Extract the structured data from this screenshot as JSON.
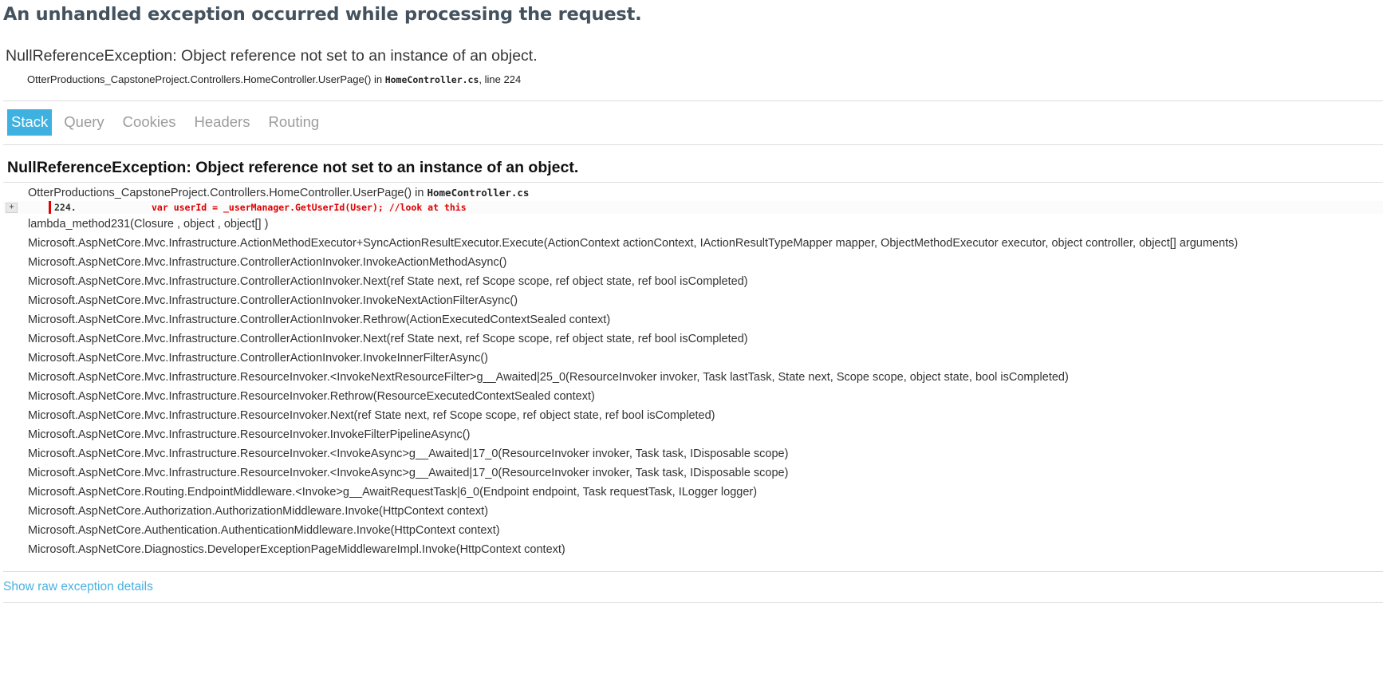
{
  "page": {
    "title": "An unhandled exception occurred while processing the request.",
    "summary": "NullReferenceException: Object reference not set to an instance of an object.",
    "location_method": "OtterProductions_CapstoneProject.Controllers.HomeController.UserPage() in ",
    "location_file": "HomeController.cs",
    "location_line": ", line 224"
  },
  "tabs": [
    {
      "label": "Stack",
      "selected": true
    },
    {
      "label": "Query",
      "selected": false
    },
    {
      "label": "Cookies",
      "selected": false
    },
    {
      "label": "Headers",
      "selected": false
    },
    {
      "label": "Routing",
      "selected": false
    }
  ],
  "stack": {
    "title": "NullReferenceException: Object reference not set to an instance of an object.",
    "first_frame_method": "OtterProductions_CapstoneProject.Controllers.HomeController.UserPage() in ",
    "first_frame_file": "HomeController.cs",
    "expander_label": "+",
    "code_line_number": "224.",
    "code_line_text": "var userId = _userManager.GetUserId(User); //look at this",
    "frames": [
      "lambda_method231(Closure , object , object[] )",
      "Microsoft.AspNetCore.Mvc.Infrastructure.ActionMethodExecutor+SyncActionResultExecutor.Execute(ActionContext actionContext, IActionResultTypeMapper mapper, ObjectMethodExecutor executor, object controller, object[] arguments)",
      "Microsoft.AspNetCore.Mvc.Infrastructure.ControllerActionInvoker.InvokeActionMethodAsync()",
      "Microsoft.AspNetCore.Mvc.Infrastructure.ControllerActionInvoker.Next(ref State next, ref Scope scope, ref object state, ref bool isCompleted)",
      "Microsoft.AspNetCore.Mvc.Infrastructure.ControllerActionInvoker.InvokeNextActionFilterAsync()",
      "Microsoft.AspNetCore.Mvc.Infrastructure.ControllerActionInvoker.Rethrow(ActionExecutedContextSealed context)",
      "Microsoft.AspNetCore.Mvc.Infrastructure.ControllerActionInvoker.Next(ref State next, ref Scope scope, ref object state, ref bool isCompleted)",
      "Microsoft.AspNetCore.Mvc.Infrastructure.ControllerActionInvoker.InvokeInnerFilterAsync()",
      "Microsoft.AspNetCore.Mvc.Infrastructure.ResourceInvoker.<InvokeNextResourceFilter>g__Awaited|25_0(ResourceInvoker invoker, Task lastTask, State next, Scope scope, object state, bool isCompleted)",
      "Microsoft.AspNetCore.Mvc.Infrastructure.ResourceInvoker.Rethrow(ResourceExecutedContextSealed context)",
      "Microsoft.AspNetCore.Mvc.Infrastructure.ResourceInvoker.Next(ref State next, ref Scope scope, ref object state, ref bool isCompleted)",
      "Microsoft.AspNetCore.Mvc.Infrastructure.ResourceInvoker.InvokeFilterPipelineAsync()",
      "Microsoft.AspNetCore.Mvc.Infrastructure.ResourceInvoker.<InvokeAsync>g__Awaited|17_0(ResourceInvoker invoker, Task task, IDisposable scope)",
      "Microsoft.AspNetCore.Mvc.Infrastructure.ResourceInvoker.<InvokeAsync>g__Awaited|17_0(ResourceInvoker invoker, Task task, IDisposable scope)",
      "Microsoft.AspNetCore.Routing.EndpointMiddleware.<Invoke>g__AwaitRequestTask|6_0(Endpoint endpoint, Task requestTask, ILogger logger)",
      "Microsoft.AspNetCore.Authorization.AuthorizationMiddleware.Invoke(HttpContext context)",
      "Microsoft.AspNetCore.Authentication.AuthenticationMiddleware.Invoke(HttpContext context)",
      "Microsoft.AspNetCore.Diagnostics.DeveloperExceptionPageMiddlewareImpl.Invoke(HttpContext context)"
    ]
  },
  "footer": {
    "raw_link_label": "Show raw exception details"
  },
  "colors": {
    "tab_selected_bg": "#3fb1e0",
    "link": "#48b1e1",
    "error_code": "#e00000"
  }
}
